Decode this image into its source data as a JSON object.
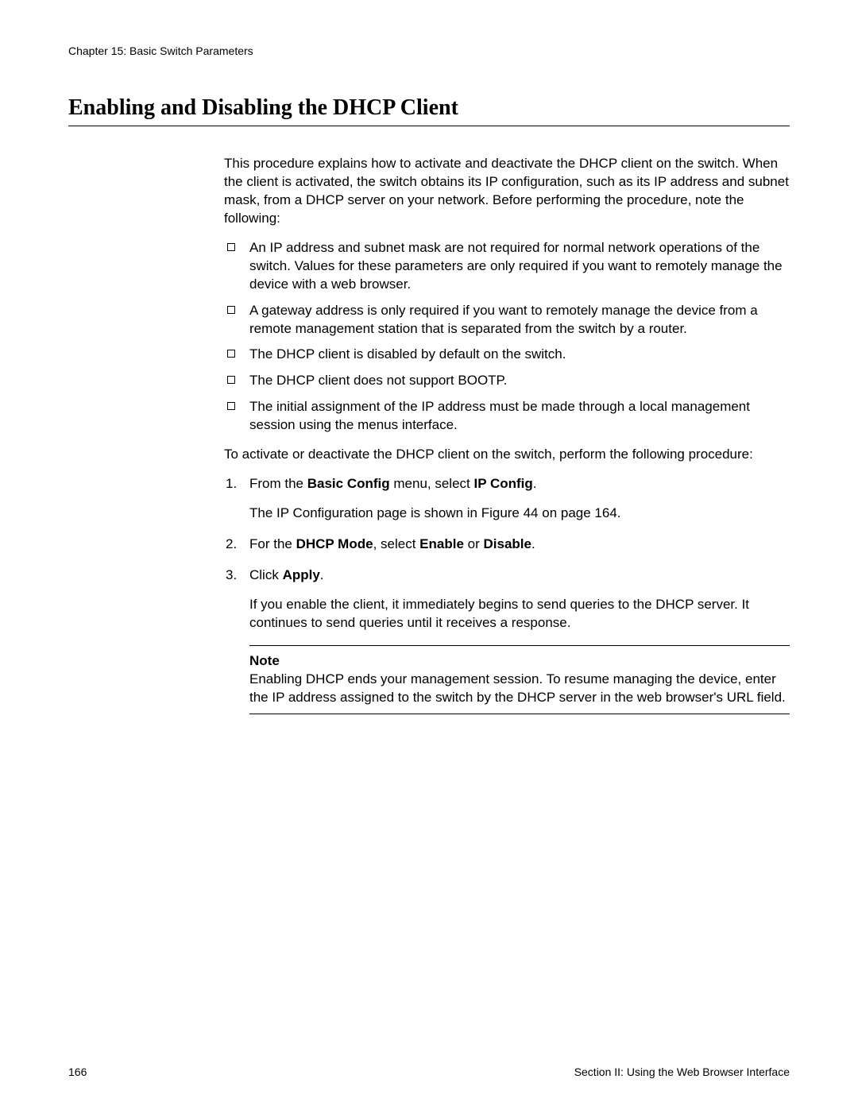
{
  "header": {
    "chapter": "Chapter 15: Basic Switch Parameters"
  },
  "title": "Enabling and Disabling the DHCP Client",
  "intro": "This procedure explains how to activate and deactivate the DHCP client on the switch. When the client is activated, the switch obtains its IP configuration, such as its IP address and subnet mask, from a DHCP server on your network. Before performing the procedure, note the following:",
  "bullets": [
    "An IP address and subnet mask are not required for normal network operations of the switch. Values for these parameters are only required if you want to remotely manage the device with a web browser.",
    "A gateway address is only required if you want to remotely manage the device from a remote management station that is separated from the switch by a router.",
    "The DHCP client is disabled by default on the switch.",
    "The DHCP client does not support BOOTP.",
    "The initial assignment of the IP address must be made through a local management session using the menus interface."
  ],
  "lead": "To activate or deactivate the DHCP client on the switch, perform the following procedure:",
  "steps": {
    "s1_a": "From the ",
    "s1_b": "Basic Config",
    "s1_c": " menu, select ",
    "s1_d": "IP Config",
    "s1_e": ".",
    "s1_sub": "The IP Configuration page is shown in Figure 44 on page 164.",
    "s2_a": "For the ",
    "s2_b": "DHCP Mode",
    "s2_c": ", select ",
    "s2_d": "Enable",
    "s2_e": " or ",
    "s2_f": "Disable",
    "s2_g": ".",
    "s3_a": "Click ",
    "s3_b": "Apply",
    "s3_c": ".",
    "s3_sub": "If you enable the client, it immediately begins to send queries to the DHCP server. It continues to send queries until it receives a response."
  },
  "note": {
    "label": "Note",
    "text": "Enabling DHCP ends your management session. To resume managing the device, enter the IP address assigned to the switch by the DHCP server in the web browser's URL field."
  },
  "footer": {
    "page_number": "166",
    "section": "Section II: Using the Web Browser Interface"
  }
}
